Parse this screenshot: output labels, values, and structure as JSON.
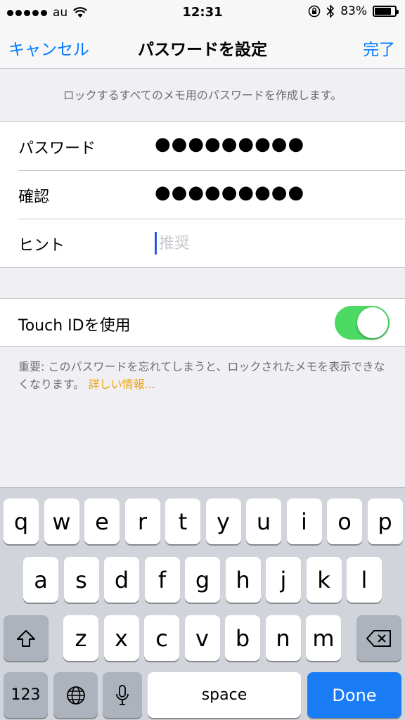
{
  "status_bar": {
    "carrier": "au",
    "time": "12:31",
    "battery_percent": "83%",
    "battery_level": 0.83,
    "signal_icon": "signal-dots-icon",
    "wifi_icon": "wifi-icon",
    "lock_icon": "rotation-lock-icon",
    "bluetooth_icon": "bluetooth-icon"
  },
  "navbar": {
    "cancel": "キャンセル",
    "title": "パスワードを設定",
    "done": "完了"
  },
  "description": "ロックするすべてのメモ用のパスワードを作成します。",
  "form": {
    "password_label": "パスワード",
    "password_value": "●●●●●●●●●",
    "confirm_label": "確認",
    "confirm_value": "●●●●●●●●●",
    "hint_label": "ヒント",
    "hint_placeholder": "推奨"
  },
  "touch_id": {
    "label": "Touch IDを使用",
    "enabled": true
  },
  "note": {
    "text": "重要: このパスワードを忘れてしまうと、ロックされたメモを表示できなくなります。",
    "link": "詳しい情報..."
  },
  "keyboard": {
    "row1": [
      "q",
      "w",
      "e",
      "r",
      "t",
      "y",
      "u",
      "i",
      "o",
      "p"
    ],
    "row2": [
      "a",
      "s",
      "d",
      "f",
      "g",
      "h",
      "j",
      "k",
      "l"
    ],
    "row3": [
      "z",
      "x",
      "c",
      "v",
      "b",
      "n",
      "m"
    ],
    "numbers": "123",
    "space": "space",
    "done": "Done",
    "colors": {
      "done": "#1a7cf5",
      "switch_on": "#4cd964",
      "link": "#f0a30a",
      "tint": "#007aff"
    }
  }
}
